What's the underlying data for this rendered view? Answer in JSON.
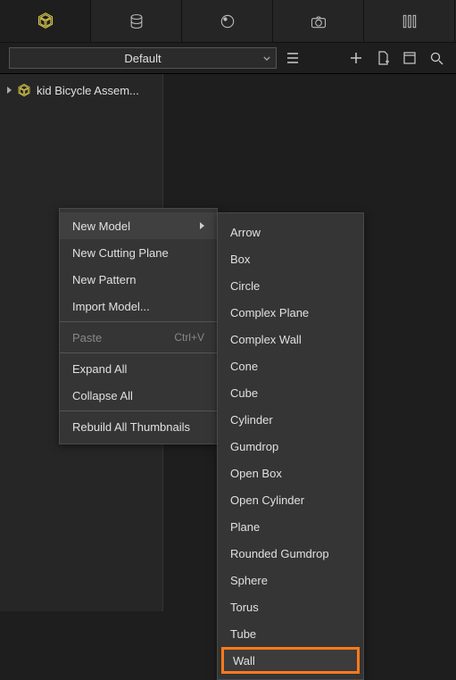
{
  "tabs": {
    "count": 5
  },
  "toolbar": {
    "combo_label": "Default"
  },
  "tree": {
    "root_label": "kid Bicycle Assem..."
  },
  "context_menu": {
    "items": [
      {
        "label": "New Model",
        "has_submenu": true,
        "hover": true
      },
      {
        "label": "New Cutting Plane"
      },
      {
        "label": "New Pattern"
      },
      {
        "label": "Import Model..."
      },
      {
        "sep": true
      },
      {
        "label": "Paste",
        "shortcut": "Ctrl+V",
        "disabled": true
      },
      {
        "sep": true
      },
      {
        "label": "Expand All"
      },
      {
        "label": "Collapse All"
      },
      {
        "sep": true
      },
      {
        "label": "Rebuild All Thumbnails"
      }
    ]
  },
  "submenu": {
    "items": [
      "Arrow",
      "Box",
      "Circle",
      "Complex Plane",
      "Complex Wall",
      "Cone",
      "Cube",
      "Cylinder",
      "Gumdrop",
      "Open Box",
      "Open Cylinder",
      "Plane",
      "Rounded Gumdrop",
      "Sphere",
      "Torus",
      "Tube",
      "Wall"
    ],
    "highlighted": "Wall"
  }
}
